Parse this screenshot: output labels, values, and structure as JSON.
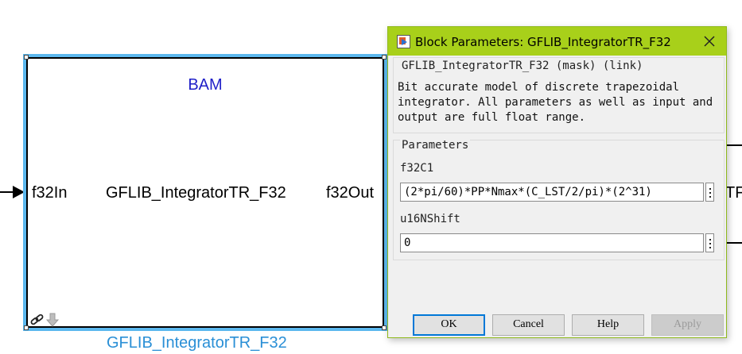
{
  "canvas": {
    "block": {
      "mask_display_label": "BAM",
      "input_port": "f32In",
      "block_display_name": "GFLIB_IntegratorTR_F32",
      "output_port": "f32Out",
      "caption": "GFLIB_IntegratorTR_F32",
      "badges": [
        "link-icon",
        "arrow-down-icon"
      ]
    },
    "right_block_partial_text": "TF",
    "colors": {
      "selection": "#5cb8ee",
      "caption": "#2a8fd6",
      "mask_label": "#1f1fc8"
    }
  },
  "dialog": {
    "title": "Block Parameters: GFLIB_IntegratorTR_F32",
    "icon": "simulink-block-icon",
    "close_icon": "close-icon",
    "titlebar_color": "#a8d01a",
    "mask_header": "GFLIB_IntegratorTR_F32 (mask) (link)",
    "mask_description": "Bit accurate model of discrete trapezoidal integrator. All parameters as well as input and output are full float range.",
    "parameters_label": "Parameters",
    "params": [
      {
        "label": "f32C1",
        "value": "(2*pi/60)*PP*Nmax*(C_LST/2/pi)*(2^31)"
      },
      {
        "label": "u16NShift",
        "value": "0"
      }
    ],
    "buttons": {
      "ok": "OK",
      "cancel": "Cancel",
      "help": "Help",
      "apply": "Apply"
    }
  }
}
